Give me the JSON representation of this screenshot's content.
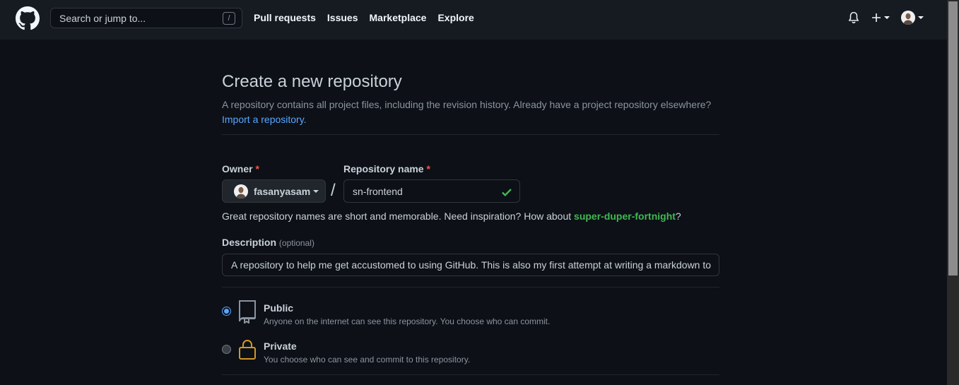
{
  "header": {
    "search_placeholder": "Search or jump to...",
    "search_shortcut": "/",
    "nav": [
      "Pull requests",
      "Issues",
      "Marketplace",
      "Explore"
    ],
    "plus_label": "+"
  },
  "page": {
    "title": "Create a new repository",
    "subtitle": "A repository contains all project files, including the revision history. Already have a project repository elsewhere?",
    "import_link": "Import a repository."
  },
  "form": {
    "owner_label": "Owner",
    "repo_label": "Repository name",
    "required_mark": "*",
    "owner_value": "fasanyasam",
    "separator": "/",
    "repo_value": "sn-frontend",
    "hint_prefix": "Great repository names are short and memorable. Need inspiration? How about ",
    "hint_suggestion": "super-duper-fortnight",
    "hint_suffix": "?",
    "description_label": "Description",
    "description_optional": "(optional)",
    "description_value": "A repository to help me get accustomed to using GitHub. This is also my first attempt at writing a markdown to"
  },
  "visibility": {
    "selected": "public",
    "options": [
      {
        "title": "Public",
        "desc": "Anyone on the internet can see this repository. You choose who can commit."
      },
      {
        "title": "Private",
        "desc": "You choose who can see and commit to this repository."
      }
    ]
  },
  "colors": {
    "accent": "#58a6ff",
    "success": "#3fb950",
    "required": "#f85149",
    "private_icon": "#d29922"
  }
}
